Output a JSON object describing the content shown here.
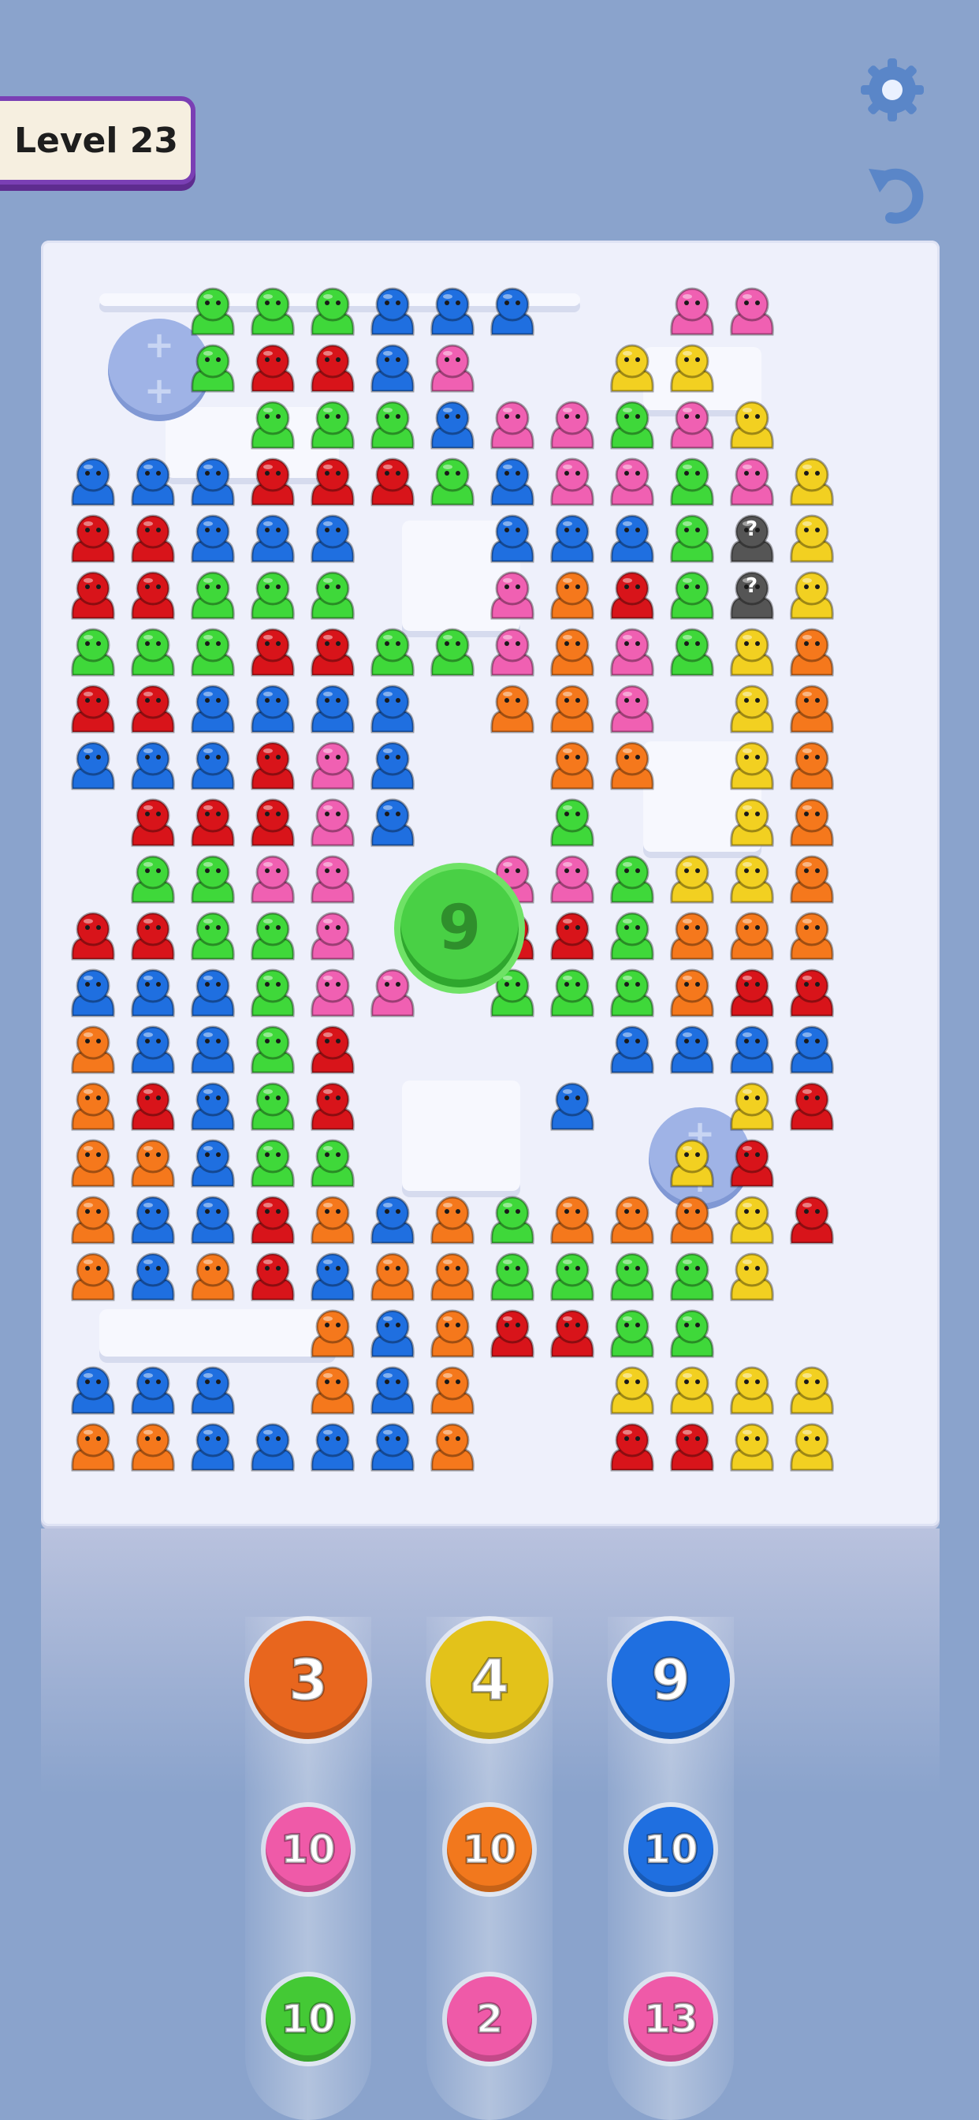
{
  "header": {
    "level_label": "Level 23",
    "settings_icon": "gear-icon",
    "undo_icon": "undo-icon"
  },
  "colors": {
    "green": "#3fd83a",
    "blue": "#1f6fe0",
    "red": "#d8141a",
    "pink": "#f060b2",
    "orange": "#f5781c",
    "yellow": "#f2d021",
    "mystery": "#555555",
    "board": "#eef0fb",
    "background": "#8aa3cc"
  },
  "board": {
    "legend": {
      "G": "green",
      "B": "blue",
      "R": "red",
      "P": "pink",
      "O": "orange",
      "Y": "yellow",
      "M": "mystery"
    },
    "rows": [
      "..GGGBBB..PP",
      "..GRRBP..YY",
      "...GGGBPPGPY",
      "BBBRRRGBPPGPY",
      "RRBBB..BBBGMY",
      "RRGGG..PORGMY",
      "GGGRRGGPOPGYO",
      "RRBBBB.OOP.YO",
      "BBBRPB..OO.YO",
      ".RRRPB..G..YO",
      ".GGPP..PPGYYO",
      "RRGGP..RRGOOO",
      "BBBGPP.GGGORR",
      "OBBGR....BBBB",
      "ORBGR...B..YR",
      "OOBGG.....YR",
      "OBBROBOGOOOYR",
      "OBORBOOGGGGY.",
      "....OBORRGG..",
      "BBB.OBO..YYYY",
      "OOBBBBO..RRYY"
    ],
    "mystery_label": "?",
    "center_counter": "9"
  },
  "tray": {
    "columns": [
      {
        "top": {
          "value": "3",
          "color": "#e8661e"
        },
        "middle": {
          "value": "10",
          "color": "#ef5aa8"
        },
        "bottom": {
          "value": "10",
          "color": "#44c935"
        }
      },
      {
        "top": {
          "value": "4",
          "color": "#e3c21a"
        },
        "middle": {
          "value": "10",
          "color": "#f2781d"
        },
        "bottom": {
          "value": "2",
          "color": "#ef5aa8"
        }
      },
      {
        "top": {
          "value": "9",
          "color": "#1f6fe0"
        },
        "middle": {
          "value": "10",
          "color": "#1f6fe0"
        },
        "bottom": {
          "value": "13",
          "color": "#ef5aa8"
        }
      }
    ]
  }
}
